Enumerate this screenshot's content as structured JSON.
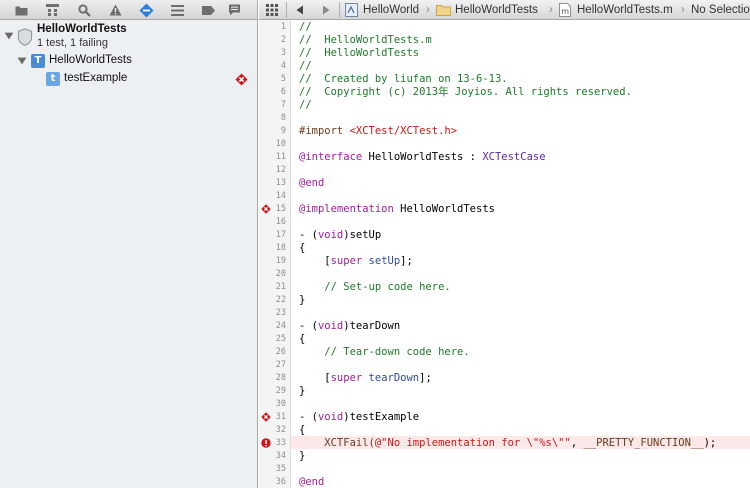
{
  "navigator": {
    "toolbar_icons": [
      "folder-icon",
      "hierarchy-icon",
      "search-icon",
      "warning-icon",
      "test-navigator-icon",
      "list-icon",
      "breakpoint-icon",
      "log-icon"
    ],
    "tree": {
      "root": {
        "title": "HelloWorldTests",
        "subtitle": "1 test, 1 failing"
      },
      "suite": {
        "label": "HelloWorldTests",
        "icon_letter": "T"
      },
      "test": {
        "label": "testExample",
        "icon_letter": "t",
        "status": "failed"
      }
    }
  },
  "jumpbar": {
    "crumbs": [
      "HelloWorld",
      "HelloWorldTests",
      "HelloWorldTests.m",
      "No Selection"
    ]
  },
  "editor": {
    "line_numbers": [
      "1",
      "2",
      "3",
      "4",
      "5",
      "6",
      "7",
      "8",
      "9",
      "10",
      "11",
      "12",
      "13",
      "14",
      "15",
      "16",
      "17",
      "18",
      "19",
      "20",
      "21",
      "22",
      "23",
      "24",
      "25",
      "26",
      "27",
      "28",
      "29",
      "30",
      "31",
      "32",
      "33",
      "34",
      "35",
      "36"
    ],
    "lines": {
      "l1": "//",
      "l2": "//  HelloWorldTests.m",
      "l3": "//  HelloWorldTests",
      "l4": "//",
      "l5": "//  Created by liufan on 13-6-13.",
      "l6": "//  Copyright (c) 2013年 Joyios. All rights reserved.",
      "l7": "//",
      "l9_a": "#import ",
      "l9_b": "<XCTest/XCTest.h>",
      "l11_a": "@interface",
      "l11_b": " HelloWorldTests : ",
      "l11_c": "XCTestCase",
      "l13": "@end",
      "l15_a": "@implementation",
      "l15_b": " HelloWorldTests",
      "l17_a": "- (",
      "l17_b": "void",
      "l17_c": ")setUp",
      "l18": "{",
      "l19_a": "    [",
      "l19_b": "super",
      "l19_c": " ",
      "l19_d": "setUp",
      "l19_e": "];",
      "l21": "    // Set-up code here.",
      "l22": "}",
      "l24_a": "- (",
      "l24_b": "void",
      "l24_c": ")tearDown",
      "l25": "{",
      "l26": "    // Tear-down code here.",
      "l28_a": "    [",
      "l28_b": "super",
      "l28_c": " ",
      "l28_d": "tearDown",
      "l28_e": "];",
      "l29": "}",
      "l31_a": "- (",
      "l31_b": "void",
      "l31_c": ")testExample",
      "l32": "{",
      "l33_a": "    XCTFail(",
      "l33_b": "@\"No implementation for \\\"%s\\\"\"",
      "l33_c": ", ",
      "l33_d": "__PRETTY_FUNCTION__",
      "l33_e": ");",
      "l34": "}",
      "l36": "@end"
    }
  },
  "colors": {
    "comment": "#1f7a28",
    "keyword": "#a21d9e",
    "string": "#c41a16",
    "class": "#5d27a1",
    "error": "#d0161b",
    "error_line_bg": "#fbe8e8"
  }
}
